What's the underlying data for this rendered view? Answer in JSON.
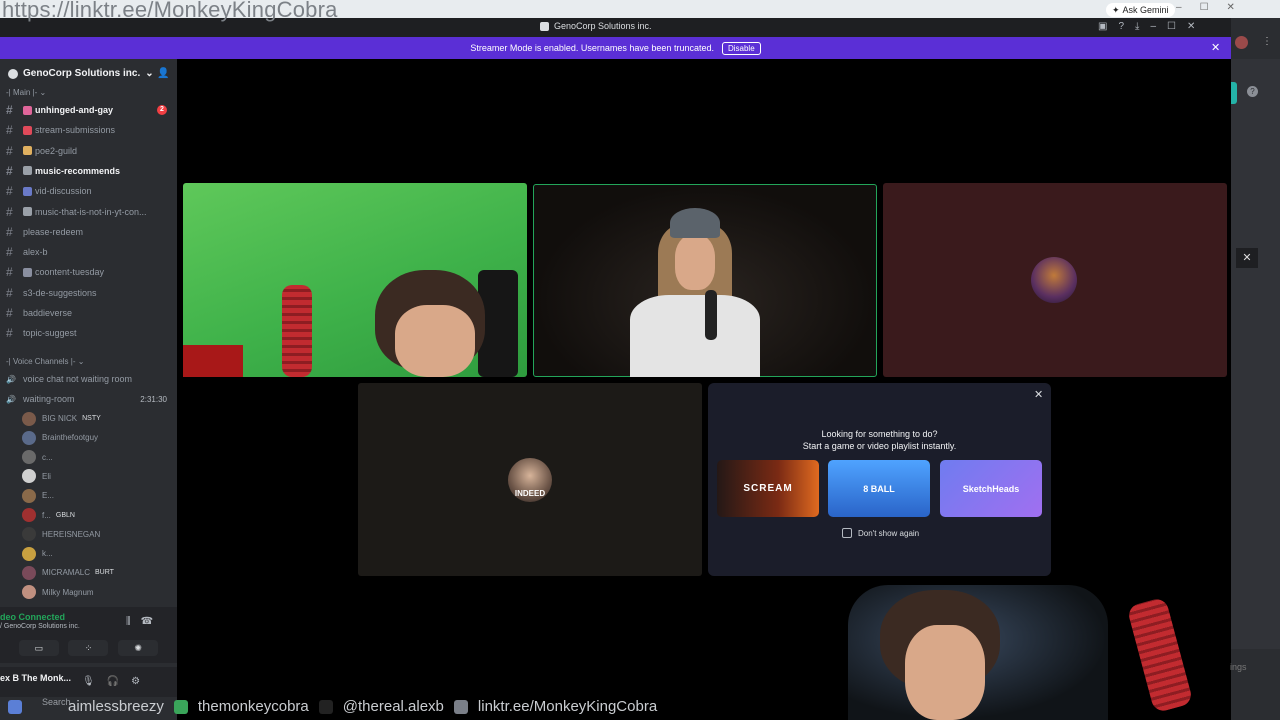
{
  "browser": {
    "overlay_url": "https://linktr.ee/MonkeyKingCobra",
    "ask_gemini": "Ask Gemini"
  },
  "window": {
    "title": "GenoCorp Solutions inc."
  },
  "banner": {
    "text": "Streamer Mode is enabled. Usernames have been truncated.",
    "disable_label": "Disable"
  },
  "sidebar": {
    "server_name": "GenoCorp Solutions inc.",
    "main_category": "-| Main |-",
    "channels": [
      {
        "name": "unhinged-and-gay",
        "unread": true,
        "badge": "2",
        "emoji_color": "#e0669a"
      },
      {
        "name": "stream-submissions",
        "unread": false,
        "emoji_color": "#e04a5a"
      },
      {
        "name": "poe2-guild",
        "unread": false,
        "emoji_color": "#e0b060"
      },
      {
        "name": "music-recommends",
        "unread": true,
        "emoji_color": "#9aa0a8"
      },
      {
        "name": "vid-discussion",
        "unread": false,
        "emoji_color": "#6a7ac8"
      },
      {
        "name": "music-that-is-not-in-yt-con...",
        "unread": false,
        "emoji_color": "#9aa0a8"
      },
      {
        "name": "please-redeem",
        "unread": false
      },
      {
        "name": "alex-b",
        "unread": false
      },
      {
        "name": "coontent-tuesday",
        "unread": false,
        "emoji_color": "#8a8fa0"
      },
      {
        "name": "s3-de-suggestions",
        "unread": false
      },
      {
        "name": "baddieverse",
        "unread": false
      },
      {
        "name": "topic-suggest",
        "unread": false
      }
    ],
    "voice_category": "-| Voice Channels |-",
    "voice_channels": [
      {
        "name": "voice chat not waiting room"
      },
      {
        "name": "waiting-room",
        "timer": "2:31:30"
      }
    ],
    "voice_users": [
      {
        "name": "BIG NICK",
        "tag": "NSTY",
        "color": "#7a5a4a"
      },
      {
        "name": "Brainthefootguy",
        "color": "#5a6a8a"
      },
      {
        "name": "c...",
        "color": "#6a6a6a"
      },
      {
        "name": "Eli",
        "color": "#d0d0d0"
      },
      {
        "name": "E...",
        "color": "#8a6a4a"
      },
      {
        "name": "f...",
        "tag": "GBLN",
        "color": "#a03030"
      },
      {
        "name": "HEREISNEGAN",
        "color": "#3a3a3a"
      },
      {
        "name": "k...",
        "color": "#c8a040"
      },
      {
        "name": "MICRAMALC",
        "tag": "BURT",
        "color": "#7a4a5a"
      },
      {
        "name": "Milky Magnum",
        "color": "#c09080"
      }
    ],
    "voice_status": "deo Connected",
    "voice_server": "/ GenoCorp Solutions inc.",
    "user_name": "ex B The Monk..."
  },
  "call": {
    "indeed_label": "INDEED"
  },
  "popup": {
    "title_line1": "Looking for something to do?",
    "title_line2": "Start a game or video playlist instantly.",
    "activities": [
      "SCREAM",
      "8 BALL",
      "SketchHeads"
    ],
    "dont_show": "Don't show again"
  },
  "ticker": {
    "search": "Search",
    "items": [
      "aimlessbreezy",
      "themonkeycobra",
      "@thereal.alexb",
      "linktr.ee/MonkeyKingCobra"
    ]
  },
  "ghost": {
    "settings": "ings"
  }
}
